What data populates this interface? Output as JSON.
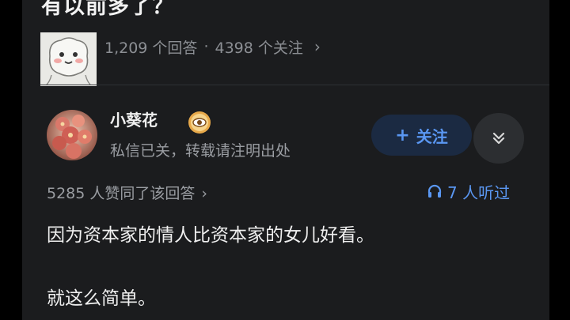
{
  "question": {
    "title": "有以前多了？",
    "answer_count": "1,209 个回答",
    "separator": "·",
    "follow_count": "4398 个关注",
    "chevron": "›"
  },
  "author": {
    "name": "小葵花",
    "badge_icon": "eye-badge-icon",
    "bio": "私信已关，转载请注明出处",
    "follow_plus": "+",
    "follow_label": "关注",
    "expand_icon": "chevron-double-down-icon"
  },
  "answer": {
    "likes": "5285 人赞同了该回答",
    "likes_chevron": "›",
    "listen_icon": "headphones-icon",
    "listened": "7 人听过",
    "paragraphs": [
      "因为资本家的情人比资本家的女儿好看。",
      "就这么简单。"
    ]
  },
  "colors": {
    "accent": "#5a97f2",
    "background": "#1b1c1e",
    "text": "#efefef",
    "muted": "#9a9da2"
  }
}
